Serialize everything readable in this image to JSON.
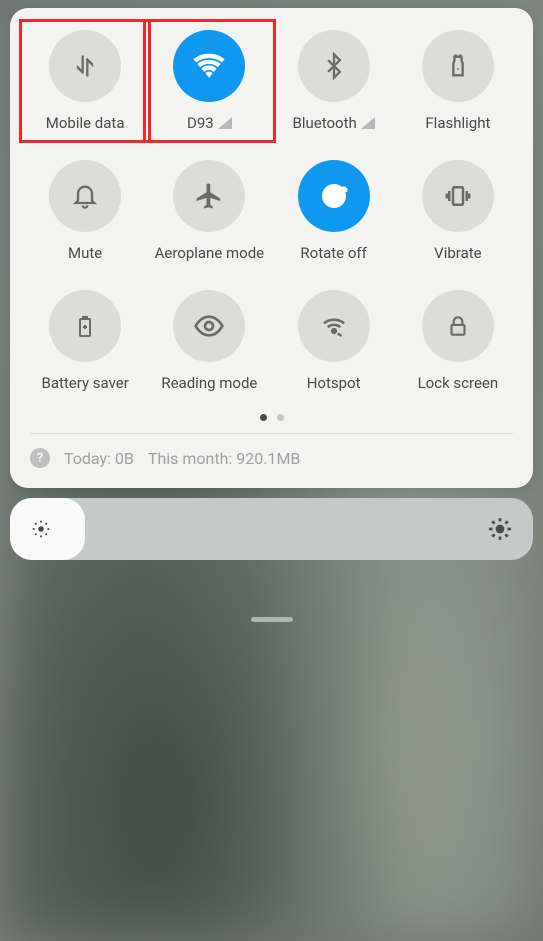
{
  "tiles": [
    {
      "label": "Mobile data",
      "active": false,
      "hasSignal": false,
      "highlighted": true
    },
    {
      "label": "D93",
      "active": true,
      "hasSignal": true,
      "highlighted": true
    },
    {
      "label": "Bluetooth",
      "active": false,
      "hasSignal": true,
      "highlighted": false
    },
    {
      "label": "Flashlight",
      "active": false,
      "hasSignal": false,
      "highlighted": false
    },
    {
      "label": "Mute",
      "active": false,
      "hasSignal": false,
      "highlighted": false
    },
    {
      "label": "Aeroplane mode",
      "active": false,
      "hasSignal": false,
      "highlighted": false
    },
    {
      "label": "Rotate off",
      "active": true,
      "hasSignal": false,
      "highlighted": false
    },
    {
      "label": "Vibrate",
      "active": false,
      "hasSignal": false,
      "highlighted": false
    },
    {
      "label": "Battery saver",
      "active": false,
      "hasSignal": false,
      "highlighted": false
    },
    {
      "label": "Reading mode",
      "active": false,
      "hasSignal": false,
      "highlighted": false
    },
    {
      "label": "Hotspot",
      "active": false,
      "hasSignal": false,
      "highlighted": false
    },
    {
      "label": "Lock screen",
      "active": false,
      "hasSignal": false,
      "highlighted": false
    }
  ],
  "pagination": {
    "current": 0,
    "total": 2
  },
  "dataUsage": {
    "today": "Today: 0B",
    "month": "This month: 920.1MB"
  },
  "colors": {
    "accent": "#0f98f0",
    "highlight": "#ef2828"
  }
}
